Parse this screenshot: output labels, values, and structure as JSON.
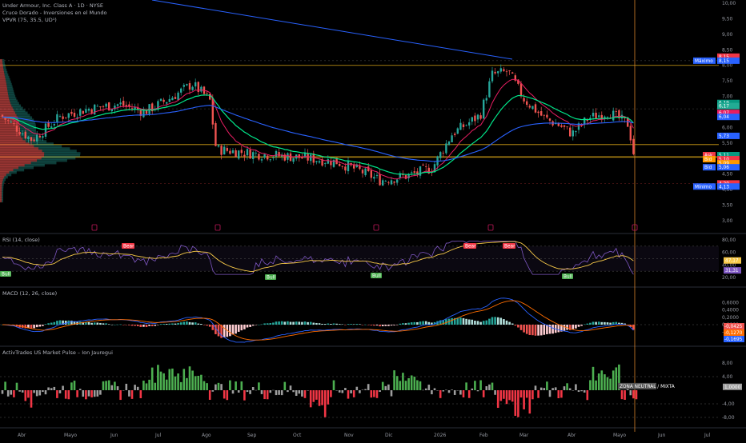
{
  "header": {
    "title": "Under Armour, Inc. Class A · 1D · NYSE",
    "indicator1": "Cruce Dorado - Inversiones en el Mundo",
    "indicator2": "VPVR (75, 35.5, UD¹)"
  },
  "colors": {
    "background": "#000000",
    "up": "#26a69a",
    "down": "#ef5350",
    "ema_fast": "#e91e63",
    "ema_mid": "#00e68a",
    "sma_long": "#2962ff",
    "rsi": "#7e57c2",
    "rsi_ma": "#f7c948",
    "macd": "#2962ff",
    "signal": "#ff6d00",
    "hist_up": "#26a69a",
    "hist_down": "#ef5350",
    "pulse_up": "#4caf50",
    "pulse_down": "#f23645",
    "pulse_neutral": "#9e9e9e",
    "level_orange": "#d4a017",
    "cursor": "#d9822b"
  },
  "price_axis": {
    "ticks": [
      "10,00",
      "9,50",
      "9,00",
      "8,50",
      "8,00",
      "7,50",
      "7,00",
      "6,50",
      "6,00",
      "5,50",
      "5,00",
      "4,50",
      "4,00",
      "3,50",
      "3,00"
    ],
    "tags": [
      {
        "text": "8,15",
        "color": "#f23645"
      },
      {
        "text": "8,15",
        "color": "#2962ff"
      },
      {
        "text": "6,19",
        "color": "#089981"
      },
      {
        "text": "6,17",
        "color": "#22ab94"
      },
      {
        "text": "6,07",
        "color": "#e91e63"
      },
      {
        "text": "6,04",
        "color": "#2962ff"
      },
      {
        "text": "5,73",
        "color": "#2962ff"
      },
      {
        "text": "5,11",
        "color": "#089981"
      },
      {
        "text": "5,10",
        "color": "#f23645"
      },
      {
        "text": "5,09",
        "color": "#ff9800"
      },
      {
        "text": "5,06",
        "color": "#2962ff"
      },
      {
        "text": "4,20",
        "color": "#f23645"
      },
      {
        "text": "4,13",
        "color": "#2962ff"
      }
    ],
    "side_labels": [
      "Máximo",
      "Ask",
      "Bid",
      "Mínimo",
      "Bid"
    ]
  },
  "rsi_panel": {
    "title": "RSI (14, close)",
    "ticks": [
      "80,00",
      "60,00",
      "40,00",
      "20,00"
    ],
    "tags": [
      {
        "text": "47,17",
        "color": "#f7c948"
      },
      {
        "text": "31,31",
        "color": "#7e57c2"
      }
    ],
    "bear_label": "Bear",
    "bull_label": "Bull"
  },
  "macd_panel": {
    "title": "MACD (12, 26, close)",
    "ticks": [
      "0,6000",
      "0,4000",
      "0,2000",
      "0,0000",
      "-0,2000"
    ],
    "tags": [
      {
        "text": "-0,0425",
        "color": "#ef5350"
      },
      {
        "text": "-0,1270",
        "color": "#ff6d00"
      },
      {
        "text": "-0,1695",
        "color": "#2962ff"
      }
    ]
  },
  "pulse_panel": {
    "title": "ActivTrades US Market Pulse – Ion Jauregui",
    "ticks": [
      "8,00",
      "4,00",
      "-4,00",
      "-8,00"
    ],
    "tag": {
      "text": "1,0000",
      "color": "#9e9e9e"
    },
    "zone_label": "ZONA NEUTRAL / MIXTA"
  },
  "time_axis": [
    "Abr",
    "Mayo",
    "Jun",
    "Jul",
    "Ago",
    "Sep",
    "Oct",
    "Nov",
    "Dic",
    "2026",
    "Feb",
    "Mar",
    "Abr",
    "Mayo",
    "Jun",
    "Jul"
  ],
  "chart_data": {
    "type": "candlestick",
    "symbol": "Under Armour, Inc. Class A",
    "interval": "1D",
    "exchange": "NYSE",
    "ylim": [
      3.0,
      10.0
    ],
    "period_x": [
      "Abr",
      "Mayo",
      "Jun",
      "Jul",
      "Ago",
      "Sep",
      "Oct",
      "Nov",
      "Dic",
      "2026",
      "Feb",
      "Mar",
      "Abr",
      "Mayo"
    ],
    "approx_close": [
      6.4,
      6.4,
      6.95,
      7.3,
      5.3,
      5.05,
      4.9,
      4.55,
      4.5,
      5.6,
      7.7,
      6.3,
      6.15,
      5.11
    ],
    "levels": {
      "maximo": 8.15,
      "minimo": 4.13,
      "ask": 5.1,
      "bid": 5.06,
      "last": 5.11
    },
    "rsi": {
      "title": "RSI (14, close)",
      "ylim": [
        20,
        80
      ],
      "last": 31.31,
      "ma_last": 47.17
    },
    "macd": {
      "title": "MACD (12, 26, close)",
      "hist_last": -0.0425,
      "signal_last": -0.127,
      "macd_last": -0.1695
    },
    "pulse": {
      "title": "ActivTrades US Market Pulse – Ion Jauregui",
      "ylim": [
        -8,
        8
      ],
      "last": 1.0
    }
  }
}
